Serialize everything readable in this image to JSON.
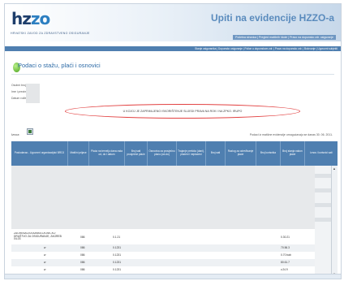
{
  "header": {
    "logo_main": "hz",
    "logo_accent": "zo",
    "logo_subtitle": "HRVATSKI ZAVOD ZA ZDRAVSTVENO OSIGURANJE",
    "app_title": "Upiti na evidencije HZZO-a",
    "top_links": "Početna stranica | Pregled matičnih škole | Pravo na dopunsko zdr. osiguranje",
    "nav_text": "Stanje osiguranika | Dopunsko osiguranje | Police u dopunskom zdr. | Pravo na dopunsko zdr. | Bolovanje | Ugovorni subjekti"
  },
  "page": {
    "title": "Podaci o stažu, plaći i osnovici",
    "labels": [
      "Osobni broj:",
      "Ime i prezime:",
      "Datum rođenja:"
    ],
    "notice": "U KOJOJ JE ZAPRIMLJENO ISKORIŠTENJE SLIJEDI PRAVA NA ROK I NA ZPKO. IRUPO",
    "export_label": "Izvoz:",
    "update_note": "Podaci iz matične evidencije omogućavaju se danas 30. 06. 2011."
  },
  "table": {
    "headers": [
      "Poslodavac - Ugovorni organizacijski BROJ",
      "Matični prijave",
      "Plaća na temelju dana rada od, do i datum",
      "Broj sati prosječne plaće",
      "Osnovica za prosječnu plaću (od-do)",
      "Trajanje prekida (dani), plaćeni i neplaćeni",
      "Broj sati",
      "Razlog za određivanje plaće",
      "Broj korisnika",
      "Broj stanja nakon plaće",
      "Iznos i korisnici sati"
    ],
    "rows": [
      {
        "employer": "ZAGREBAČKA BANKA DIONIČKO DRUŠTVO ZA OSIGURANJE, ZAGREB 04-03",
        "code": "086",
        "period": "0.1.21",
        "amount": "0.30.21"
      },
      {
        "employer": "w",
        "code": "086",
        "period": "0.1231",
        "amount": "70.56.3"
      },
      {
        "employer": "w",
        "code": "086",
        "period": "0.1231",
        "amount": "0.70 bab"
      },
      {
        "employer": "w",
        "code": "086",
        "period": "0.1231",
        "amount": "80.61.7"
      },
      {
        "employer": "w",
        "code": "086",
        "period": "0.1231",
        "amount": "v.24.9"
      }
    ]
  },
  "colors": {
    "header_blue": "#4f7fb0",
    "title_blue": "#2c6aa6",
    "ellipse_red": "#e24141"
  },
  "icons": {
    "title": "green-circle-icon",
    "export": "excel-icon"
  }
}
